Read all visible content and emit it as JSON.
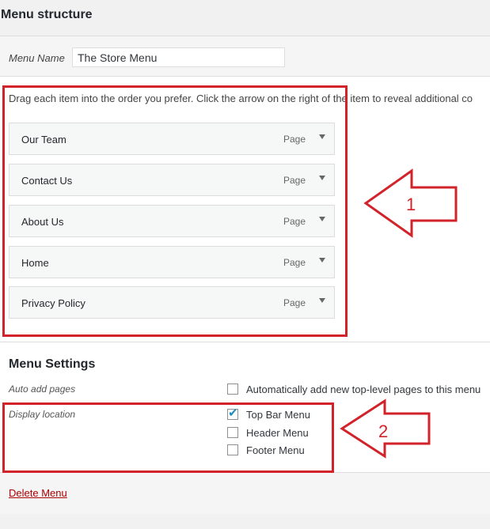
{
  "page": {
    "heading": "Menu structure"
  },
  "menu_name": {
    "label": "Menu Name",
    "value": "The Store Menu"
  },
  "instructions": "Drag each item into the order you prefer. Click the arrow on the right of the item to reveal additional co",
  "menu_items": [
    {
      "title": "Our Team",
      "type": "Page"
    },
    {
      "title": "Contact Us",
      "type": "Page"
    },
    {
      "title": "About Us",
      "type": "Page"
    },
    {
      "title": "Home",
      "type": "Page"
    },
    {
      "title": "Privacy Policy",
      "type": "Page"
    }
  ],
  "settings": {
    "title": "Menu Settings",
    "auto_add": {
      "label": "Auto add pages",
      "option": "Automatically add new top-level pages to this menu",
      "checked": false
    },
    "display_location": {
      "label": "Display location",
      "options": [
        {
          "label": "Top Bar Menu",
          "checked": true
        },
        {
          "label": "Header Menu",
          "checked": false
        },
        {
          "label": "Footer Menu",
          "checked": false
        }
      ]
    }
  },
  "delete_link": "Delete Menu",
  "annotations": {
    "callout_1": "1",
    "callout_2": "2",
    "color": "#d2232a"
  }
}
